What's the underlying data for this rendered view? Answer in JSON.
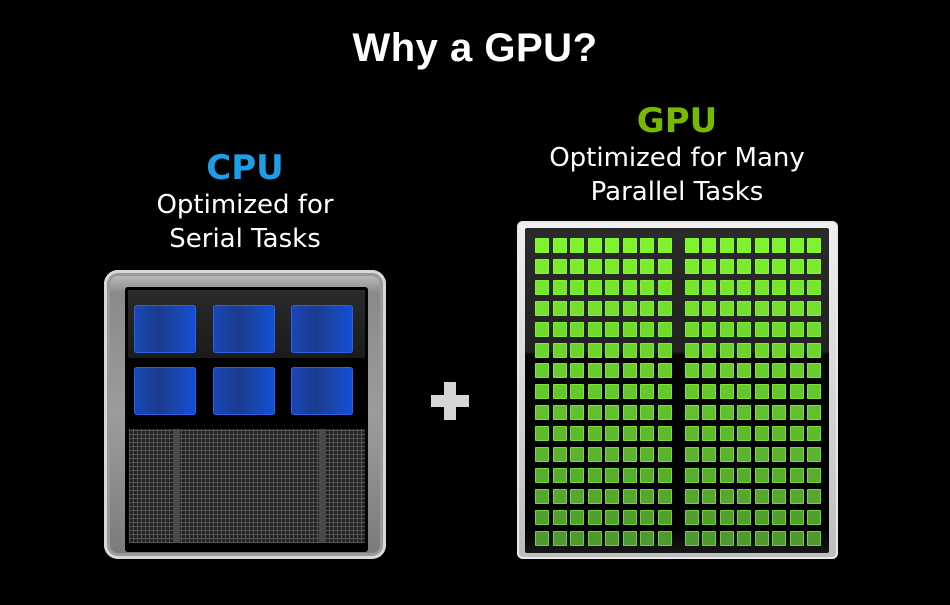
{
  "title": "Why a GPU?",
  "cpu": {
    "heading": "CPU",
    "subtitle_line1": "Optimized for",
    "subtitle_line2": "Serial Tasks",
    "heading_color": "#1e9ee6",
    "core_color": "#1a46b8",
    "core_count": 6,
    "core_rows": 2,
    "core_cols": 3
  },
  "operator": "plus-icon",
  "gpu": {
    "heading": "GPU",
    "subtitle_line1": "Optimized for Many",
    "subtitle_line2": "Parallel Tasks",
    "heading_color": "#76b900",
    "core_color_top": "#7ef22c",
    "core_color_bottom": "#4e9a2e",
    "core_rows": 15,
    "core_cols_per_block": 8,
    "core_blocks": 2
  }
}
